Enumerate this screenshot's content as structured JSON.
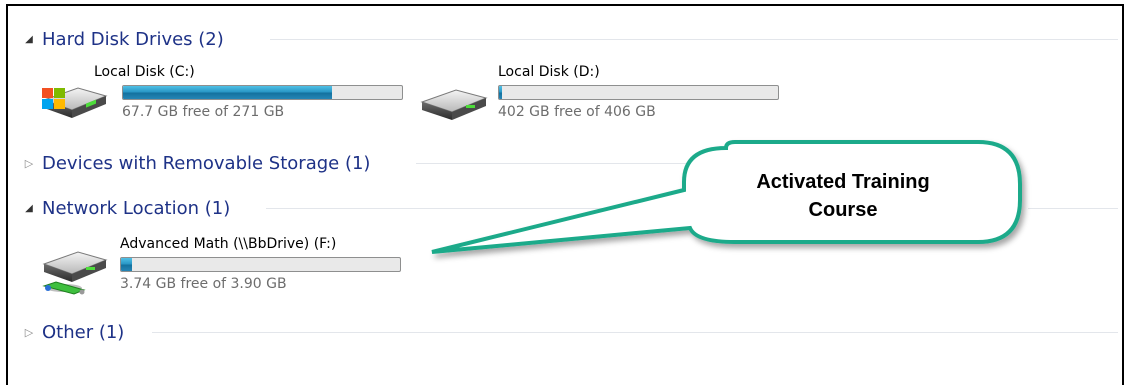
{
  "groups": [
    {
      "label": "Hard Disk Drives (2)",
      "expanded": true
    },
    {
      "label": "Devices with Removable Storage (1)",
      "expanded": false
    },
    {
      "label": "Network Location (1)",
      "expanded": true
    },
    {
      "label": "Other (1)",
      "expanded": false
    }
  ],
  "drives": [
    {
      "name": "Local Disk (C:)",
      "free_text": "67.7 GB free of 271 GB",
      "used_fraction": 0.75,
      "icon": "windows-hard-disk-icon"
    },
    {
      "name": "Local Disk (D:)",
      "free_text": "402 GB free of 406 GB",
      "used_fraction": 0.01,
      "icon": "hard-disk-icon"
    },
    {
      "name": "Advanced Math (\\\\BbDrive) (F:)",
      "free_text": "3.74 GB free of 3.90 GB",
      "used_fraction": 0.04,
      "icon": "network-drive-icon"
    }
  ],
  "callout": {
    "line1": "Activated Training",
    "line2": "Course",
    "border_color": "#1aaa8a"
  },
  "colors": {
    "group_title": "#1e3287",
    "bar_fill": "#2a97c6"
  }
}
